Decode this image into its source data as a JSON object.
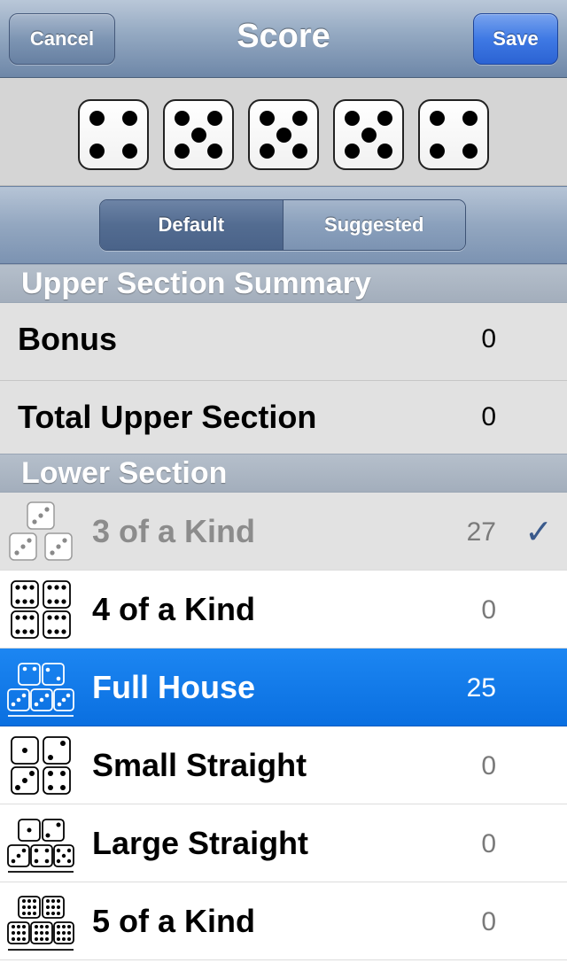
{
  "nav": {
    "title": "Score",
    "cancel_label": "Cancel",
    "save_label": "Save"
  },
  "dice": [
    4,
    5,
    5,
    5,
    4
  ],
  "segments": {
    "default_label": "Default",
    "suggested_label": "Suggested",
    "selected": "Default"
  },
  "upper": {
    "header": "Upper Section Summary",
    "rows": [
      {
        "label": "Bonus",
        "value": "0"
      },
      {
        "label": "Total Upper Section",
        "value": "0"
      }
    ]
  },
  "lower": {
    "header": "Lower Section",
    "rows": [
      {
        "label": "3 of a Kind",
        "value": "27",
        "state": "used",
        "checked": true,
        "icon": "three-of-a-kind-icon"
      },
      {
        "label": "4 of a Kind",
        "value": "0",
        "state": "normal",
        "checked": false,
        "icon": "four-of-a-kind-icon"
      },
      {
        "label": "Full House",
        "value": "25",
        "state": "selected",
        "checked": false,
        "icon": "full-house-icon"
      },
      {
        "label": "Small Straight",
        "value": "0",
        "state": "normal",
        "checked": false,
        "icon": "small-straight-icon"
      },
      {
        "label": "Large Straight",
        "value": "0",
        "state": "normal",
        "checked": false,
        "icon": "large-straight-icon"
      },
      {
        "label": "5 of a Kind",
        "value": "0",
        "state": "normal",
        "checked": false,
        "icon": "five-of-a-kind-icon"
      }
    ],
    "check_glyph": "✓"
  },
  "colors": {
    "selected_row": "#0a6fe0",
    "check": "#3a5a8c",
    "save_button": "#3f79e4"
  }
}
